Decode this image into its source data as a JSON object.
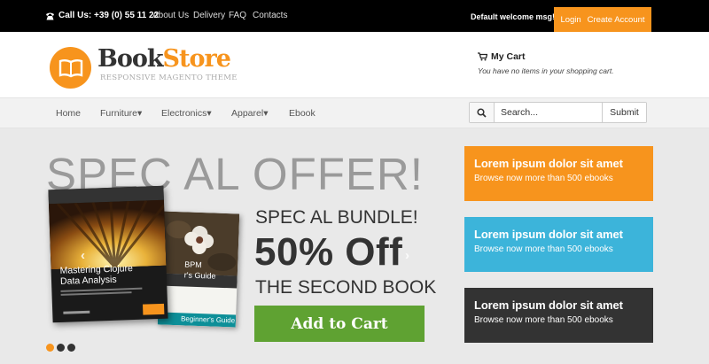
{
  "topbar": {
    "phone": "Call Us: +39 (0) 55 11 22",
    "links": [
      "About Us",
      "Delivery",
      "FAQ",
      "Contacts"
    ],
    "welcome": "Default welcome msg!",
    "login": "Login",
    "create_account": "Create Account"
  },
  "header": {
    "logo_book": "Book",
    "logo_store": "Store",
    "logo_subtitle": "RESPONSIVE MAGENTO THEME",
    "cart_title": "My Cart",
    "cart_status": "You have no items in your shopping cart."
  },
  "nav": {
    "items": [
      "Home",
      "Furniture",
      "Electronics",
      "Apparel",
      "Ebook"
    ],
    "search_placeholder": "Search...",
    "submit": "Submit"
  },
  "hero": {
    "headline": "SPEC AL OFFER!",
    "bundle": "SPEC AL BUNDLE!",
    "discount": "50% Off",
    "second_book": "THE SECOND BOOK",
    "add_to_cart": "Add to Cart",
    "book1_title_line1": "Mastering Clojure",
    "book1_title_line2": "Data Analysis",
    "book2_title_line1": "BPM",
    "book2_title_line2": "r's Guide",
    "book2_series": "Beginner's Guide",
    "slide_count": 3,
    "active_slide": 1
  },
  "promos": [
    {
      "title": "Lorem ipsum dolor sit amet",
      "subtitle": "Browse now more than 500 ebooks",
      "color": "#f7941d"
    },
    {
      "title": "Lorem ipsum dolor sit amet",
      "subtitle": "Browse now more than 500 ebooks",
      "color": "#3cb4da"
    },
    {
      "title": "Lorem ipsum dolor sit amet",
      "subtitle": "Browse now more than 500 ebooks",
      "color": "#333333"
    }
  ],
  "colors": {
    "accent": "#f7941d",
    "green": "#5fa232",
    "dot_active": "#f7941d",
    "dot_inactive": "#333333"
  }
}
